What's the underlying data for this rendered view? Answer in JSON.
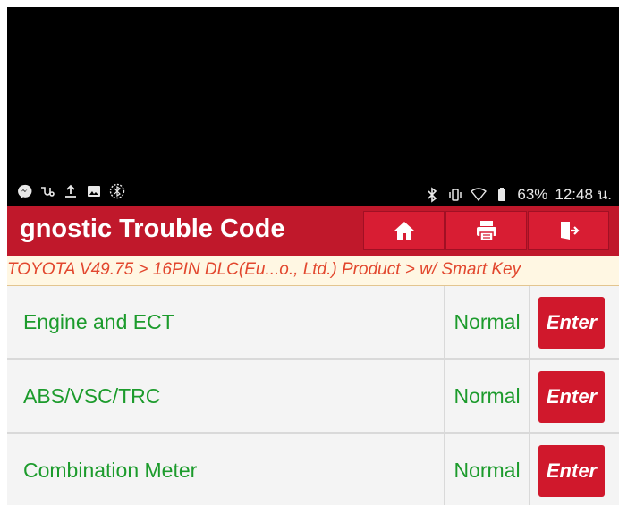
{
  "status_bar": {
    "battery": "63%",
    "time": "12:48 น.",
    "left_icons": [
      "messenger-icon",
      "vpn-key-icon",
      "upload-icon",
      "image-icon",
      "bluetooth-icon"
    ],
    "right_icons": [
      "bluetooth-icon",
      "vibrate-icon",
      "wifi-icon",
      "battery-icon"
    ]
  },
  "header": {
    "title": "gnostic Trouble Code",
    "buttons": [
      "home-icon",
      "print-icon",
      "exit-icon"
    ],
    "colors": {
      "bar": "#c0182b",
      "button": "#d81d33"
    }
  },
  "breadcrumb": {
    "text": "TOYOTA V49.75 > 16PIN DLC(Eu...o., Ltd.) Product > w/ Smart Key"
  },
  "systems": [
    {
      "name": "Engine and ECT",
      "status": "Normal",
      "action": "Enter"
    },
    {
      "name": "ABS/VSC/TRC",
      "status": "Normal",
      "action": "Enter"
    },
    {
      "name": "Combination Meter",
      "status": "Normal",
      "action": "Enter"
    }
  ],
  "colors": {
    "label_green": "#1c9b2c",
    "enter_red": "#d0182c",
    "breadcrumb_text": "#e2472e"
  }
}
